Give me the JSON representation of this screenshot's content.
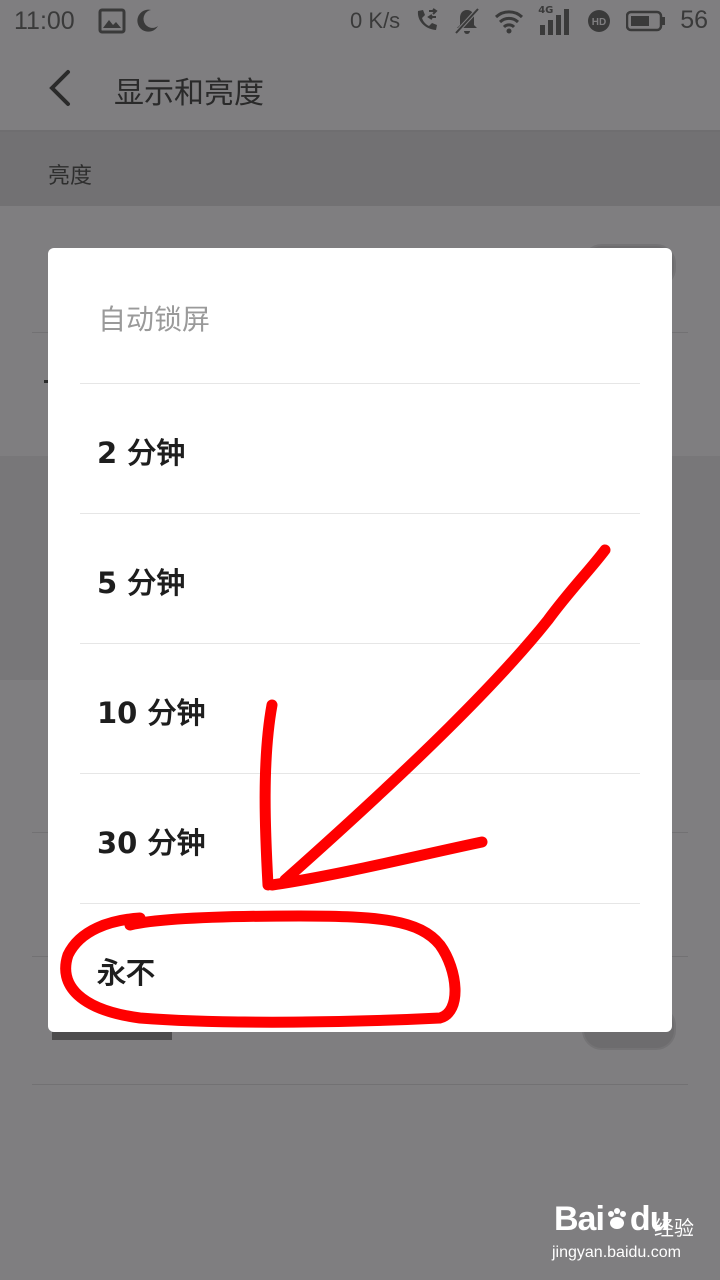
{
  "status_bar": {
    "time": "11:00",
    "net_speed": "0 K/s",
    "battery": "56",
    "network_label": "4G",
    "icons": [
      "image-icon",
      "moon-icon",
      "call-transfer-icon",
      "bell-muted-icon",
      "wifi-icon",
      "signal-icon",
      "hd-icon",
      "battery-icon"
    ]
  },
  "app_bar": {
    "back_icon": "chevron-left-icon",
    "title": "显示和亮度"
  },
  "settings": {
    "section_header": "亮度"
  },
  "dialog": {
    "title": "自动锁屏",
    "options": [
      {
        "label": "2 分钟"
      },
      {
        "label": "5 分钟"
      },
      {
        "label": "10 分钟"
      },
      {
        "label": "30 分钟"
      },
      {
        "label": "永不"
      }
    ]
  },
  "annotation": {
    "color": "#ff0000",
    "shapes": [
      "arrow",
      "circle-highlight"
    ]
  },
  "watermark": {
    "brand": "Bai",
    "brand_suffix": "du",
    "cn": "经验",
    "url": "jingyan.baidu.com"
  },
  "colors": {
    "overlay": "#7f7e80",
    "dialog_bg": "#ffffff",
    "option_text": "#1e1e1e",
    "title_text": "#9a9a9a"
  }
}
